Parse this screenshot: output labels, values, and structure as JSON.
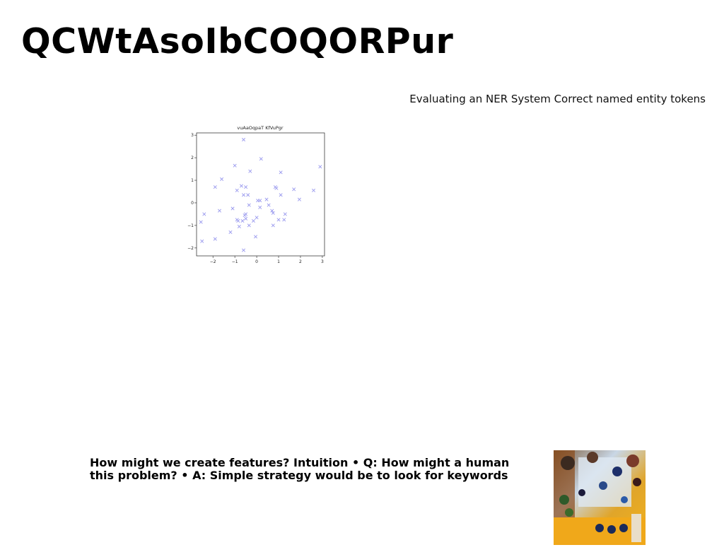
{
  "slide": {
    "title": "QCWtAsoIbCOQORPur",
    "caption": "Evaluating an NER System Correct named entity tokens",
    "body_line1": "How might we create features? Intuition • Q: How might a human",
    "body_line2": "this problem? • A: Simple strategy would be to look for keywords",
    "image_icon": "photo-thumbnail"
  },
  "chart_data": {
    "type": "scatter",
    "title": "vuAaOqpaT KfVuPgr",
    "xlabel": "",
    "ylabel": "",
    "xlim": [
      -2.75,
      3.1
    ],
    "ylim": [
      -2.35,
      3.1
    ],
    "xticks": [
      -2,
      -1,
      0,
      1,
      2,
      3
    ],
    "yticks": [
      -2,
      -1,
      0,
      1,
      2,
      3
    ],
    "xtick_labels": [
      "−2",
      "−1",
      "0",
      "1",
      "2",
      "3"
    ],
    "ytick_labels": [
      "−2",
      "−1",
      "0",
      "1",
      "2",
      "3"
    ],
    "grid": false,
    "marker": "x",
    "color": "#9999ee",
    "points": [
      [
        -0.6,
        2.8
      ],
      [
        0.2,
        1.95
      ],
      [
        2.9,
        1.6
      ],
      [
        -1.0,
        1.65
      ],
      [
        -0.3,
        1.4
      ],
      [
        1.1,
        1.35
      ],
      [
        -1.6,
        1.05
      ],
      [
        -1.9,
        0.7
      ],
      [
        -0.5,
        0.7
      ],
      [
        -0.7,
        0.75
      ],
      [
        -0.9,
        0.55
      ],
      [
        0.85,
        0.7
      ],
      [
        0.9,
        0.65
      ],
      [
        1.7,
        0.6
      ],
      [
        2.6,
        0.55
      ],
      [
        1.1,
        0.35
      ],
      [
        -0.6,
        0.35
      ],
      [
        -0.4,
        0.35
      ],
      [
        1.95,
        0.15
      ],
      [
        0.45,
        0.15
      ],
      [
        0.05,
        0.1
      ],
      [
        0.15,
        0.1
      ],
      [
        -0.35,
        -0.1
      ],
      [
        0.55,
        -0.1
      ],
      [
        0.15,
        -0.2
      ],
      [
        -1.1,
        -0.25
      ],
      [
        0.7,
        -0.35
      ],
      [
        -1.7,
        -0.35
      ],
      [
        0.75,
        -0.45
      ],
      [
        -0.5,
        -0.5
      ],
      [
        -0.55,
        -0.55
      ],
      [
        -2.4,
        -0.5
      ],
      [
        1.3,
        -0.5
      ],
      [
        0.0,
        -0.65
      ],
      [
        -0.5,
        -0.7
      ],
      [
        -0.9,
        -0.75
      ],
      [
        -0.65,
        -0.8
      ],
      [
        -0.15,
        -0.8
      ],
      [
        -0.85,
        -0.8
      ],
      [
        1.0,
        -0.75
      ],
      [
        1.25,
        -0.75
      ],
      [
        -2.55,
        -0.85
      ],
      [
        -0.35,
        -1.0
      ],
      [
        0.75,
        -1.0
      ],
      [
        -0.8,
        -1.05
      ],
      [
        -1.2,
        -1.3
      ],
      [
        -0.05,
        -1.5
      ],
      [
        -1.9,
        -1.6
      ],
      [
        -2.5,
        -1.7
      ],
      [
        -0.6,
        -2.1
      ]
    ]
  }
}
